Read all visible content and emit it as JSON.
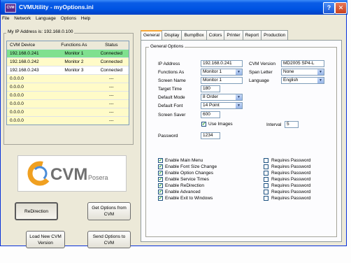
{
  "window": {
    "title": "CVMUtility - myOptions.ini",
    "app_icon_label": "CVM"
  },
  "menu": [
    "File",
    "Network",
    "Language",
    "Options",
    "Help"
  ],
  "left": {
    "ip_label": "My IP Address is: 192.168.0.100",
    "columns": [
      "CVM Device",
      "Functions As",
      "Status"
    ],
    "rows": [
      {
        "device": "192.168.0.241",
        "function": "Monitor 1",
        "status": "Connected"
      },
      {
        "device": "192.168.0.242",
        "function": "Monitor 2",
        "status": "Connected"
      },
      {
        "device": "192.168.0.243",
        "function": "Monitor 3",
        "status": "Connected"
      },
      {
        "device": "0.0.0.0",
        "function": "",
        "status": "---"
      },
      {
        "device": "0.0.0.0",
        "function": "",
        "status": "---"
      },
      {
        "device": "0.0.0.0",
        "function": "",
        "status": "---"
      },
      {
        "device": "0.0.0.0",
        "function": "",
        "status": "---"
      },
      {
        "device": "0.0.0.0",
        "function": "",
        "status": "---"
      },
      {
        "device": "0.0.0.0",
        "function": "",
        "status": "---"
      }
    ],
    "logo": {
      "text": "CVM",
      "brand": "Posera"
    },
    "buttons": {
      "redirection": "ReDirection",
      "get_options": "Get Options from CVM",
      "load_new": "Load New CVM Version",
      "send_options": "Send Options to CVM"
    }
  },
  "tabs": [
    "General",
    "Display",
    "BumpBox",
    "Colors",
    "Printer",
    "Report",
    "Production"
  ],
  "general": {
    "group_label": "General Options",
    "ip_address": {
      "label": "IP Address",
      "value": "192.168.0.241"
    },
    "functions_as": {
      "label": "Functions As",
      "value": "Monitor 1"
    },
    "screen_name": {
      "label": "Screen Name",
      "value": "Monitor 1"
    },
    "target_time": {
      "label": "Target Time",
      "value": "180"
    },
    "default_mode": {
      "label": "Default Mode",
      "value": "8 Order"
    },
    "default_font": {
      "label": "Default Font",
      "value": "14 Point"
    },
    "screen_saver": {
      "label": "Screen Saver",
      "value": "600"
    },
    "use_images": {
      "label": "Use Images",
      "checked": true
    },
    "interval": {
      "label": "Interval",
      "value": "5"
    },
    "password": {
      "label": "Password",
      "value": "1234"
    },
    "cvm_version": {
      "label": "CVM Version",
      "value": "MD2005 SP4-L"
    },
    "span_letter": {
      "label": "Span Letter",
      "value": "None"
    },
    "language": {
      "label": "Language",
      "value": "English"
    },
    "options": [
      {
        "label": "Enable Main Menu",
        "checked": true
      },
      {
        "label": "Enable Font Size Change",
        "checked": true
      },
      {
        "label": "Enable Option Changes",
        "checked": true
      },
      {
        "label": "Enable Service Times",
        "checked": true
      },
      {
        "label": "Enable ReDirection",
        "checked": true
      },
      {
        "label": "Enable Advanced",
        "checked": true
      },
      {
        "label": "Enable Exit to Windows",
        "checked": true
      }
    ],
    "requires_password_label": "Requires Password"
  },
  "colors": {
    "connected_row": "#7fe08f",
    "empty_row": "#fffbc8",
    "titlebar": "#0054e3",
    "active_tab": "#f7a535"
  }
}
